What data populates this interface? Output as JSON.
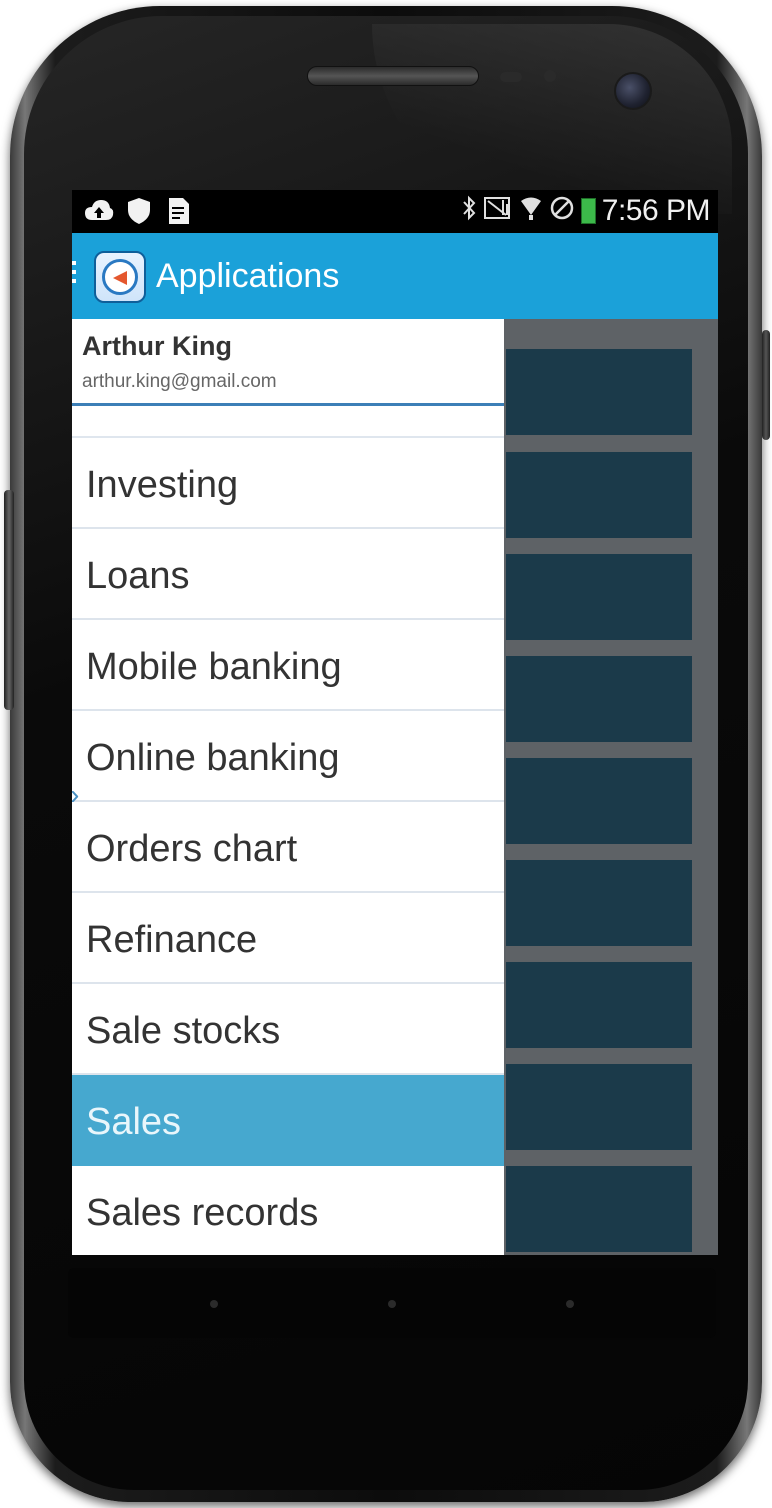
{
  "status_bar": {
    "time": "7:56 PM",
    "left_icons": [
      "cloud-upload-icon",
      "shield-icon",
      "document-icon"
    ],
    "right_icons": [
      "bluetooth-icon",
      "no-signal-icon",
      "wifi-icon",
      "blocked-icon",
      "battery-icon"
    ]
  },
  "action_bar": {
    "title": "Applications",
    "background_color": "#1ba1d9"
  },
  "drawer": {
    "user": {
      "name": "Arthur King",
      "email": "arthur.king@gmail.com"
    },
    "items": [
      {
        "label": "Investing"
      },
      {
        "label": "Loans"
      },
      {
        "label": "Mobile banking"
      },
      {
        "label": "Online banking"
      },
      {
        "label": "Orders chart"
      },
      {
        "label": "Refinance"
      },
      {
        "label": "Sale stocks"
      },
      {
        "label": "Sales",
        "selected": true
      },
      {
        "label": "Sales records"
      }
    ],
    "selected_color": "#46a8cf"
  },
  "colors": {
    "tile": "#1b3a4a",
    "content_background": "#5e6266"
  }
}
